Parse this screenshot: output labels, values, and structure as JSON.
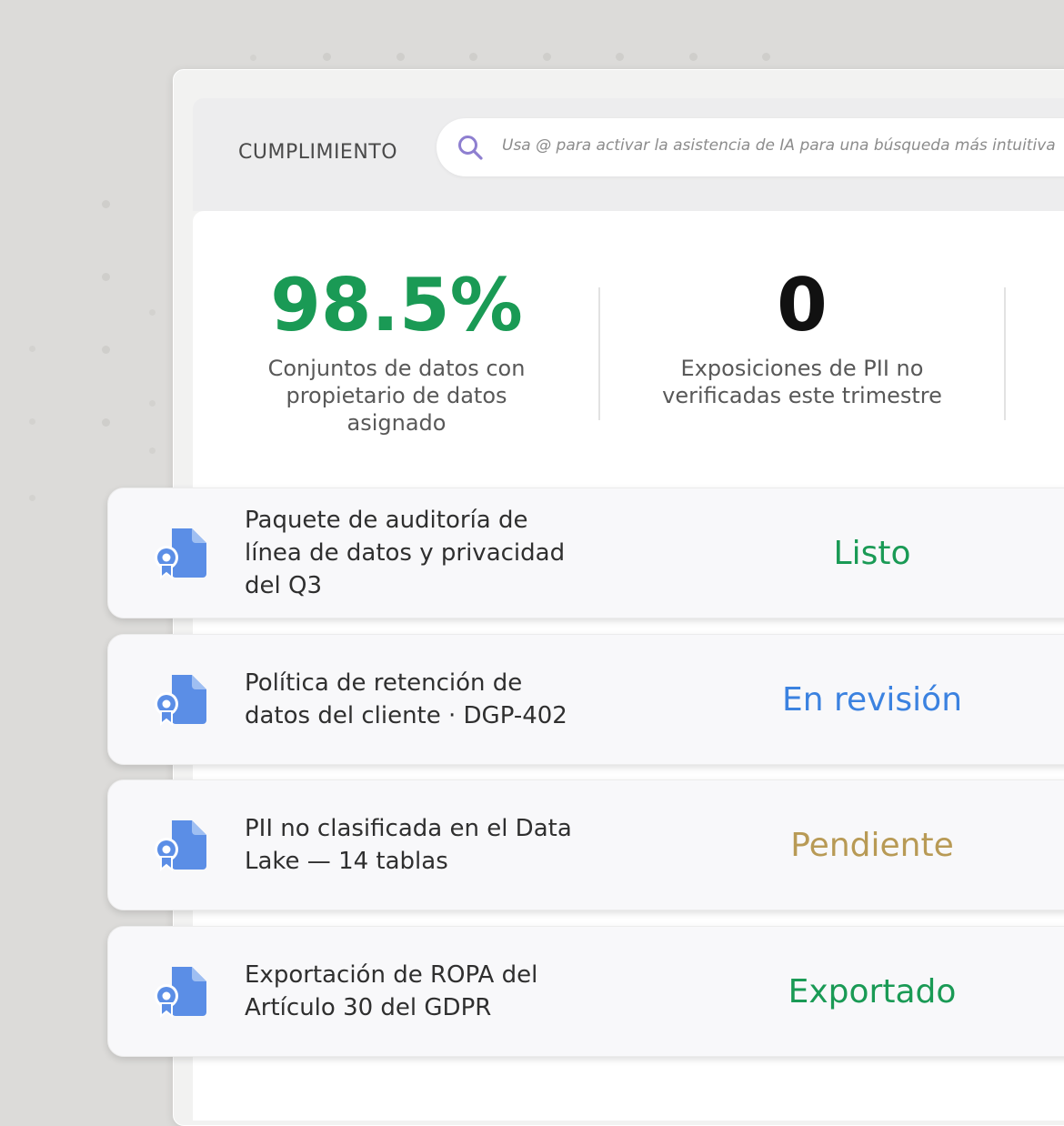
{
  "header": {
    "section_title": "CUMPLIMIENTO",
    "search": {
      "placeholder": "Usa @ para activar la asistencia de IA para una búsqueda más intuitiva",
      "icon": "search-icon"
    }
  },
  "stats": [
    {
      "value": "98.5%",
      "label": "Conjuntos de datos con propietario de datos asignado",
      "color": "#1a9a55"
    },
    {
      "value": "0",
      "label": "Exposiciones de PII no verificadas este trimestre",
      "color": "#111111"
    }
  ],
  "cards": [
    {
      "title": "Paquete de auditoría de línea de datos y privacidad del Q3",
      "status": "Listo",
      "status_color": "#1a9a55",
      "icon": "document-certificate-icon"
    },
    {
      "title": "Política de retención de datos del cliente · DGP-402",
      "status": "En revisión",
      "status_color": "#3b82e0",
      "icon": "document-certificate-icon"
    },
    {
      "title": "PII no clasificada en el Data Lake — 14 tablas",
      "status": "Pendiente",
      "status_color": "#b89a55",
      "icon": "document-certificate-icon"
    },
    {
      "title": "Exportación de ROPA del Artículo 30 del GDPR",
      "status": "Exportado",
      "status_color": "#1a9a55",
      "icon": "document-certificate-icon"
    }
  ],
  "colors": {
    "icon_blue": "#5b8ee6",
    "background": "#dcdbd9"
  }
}
